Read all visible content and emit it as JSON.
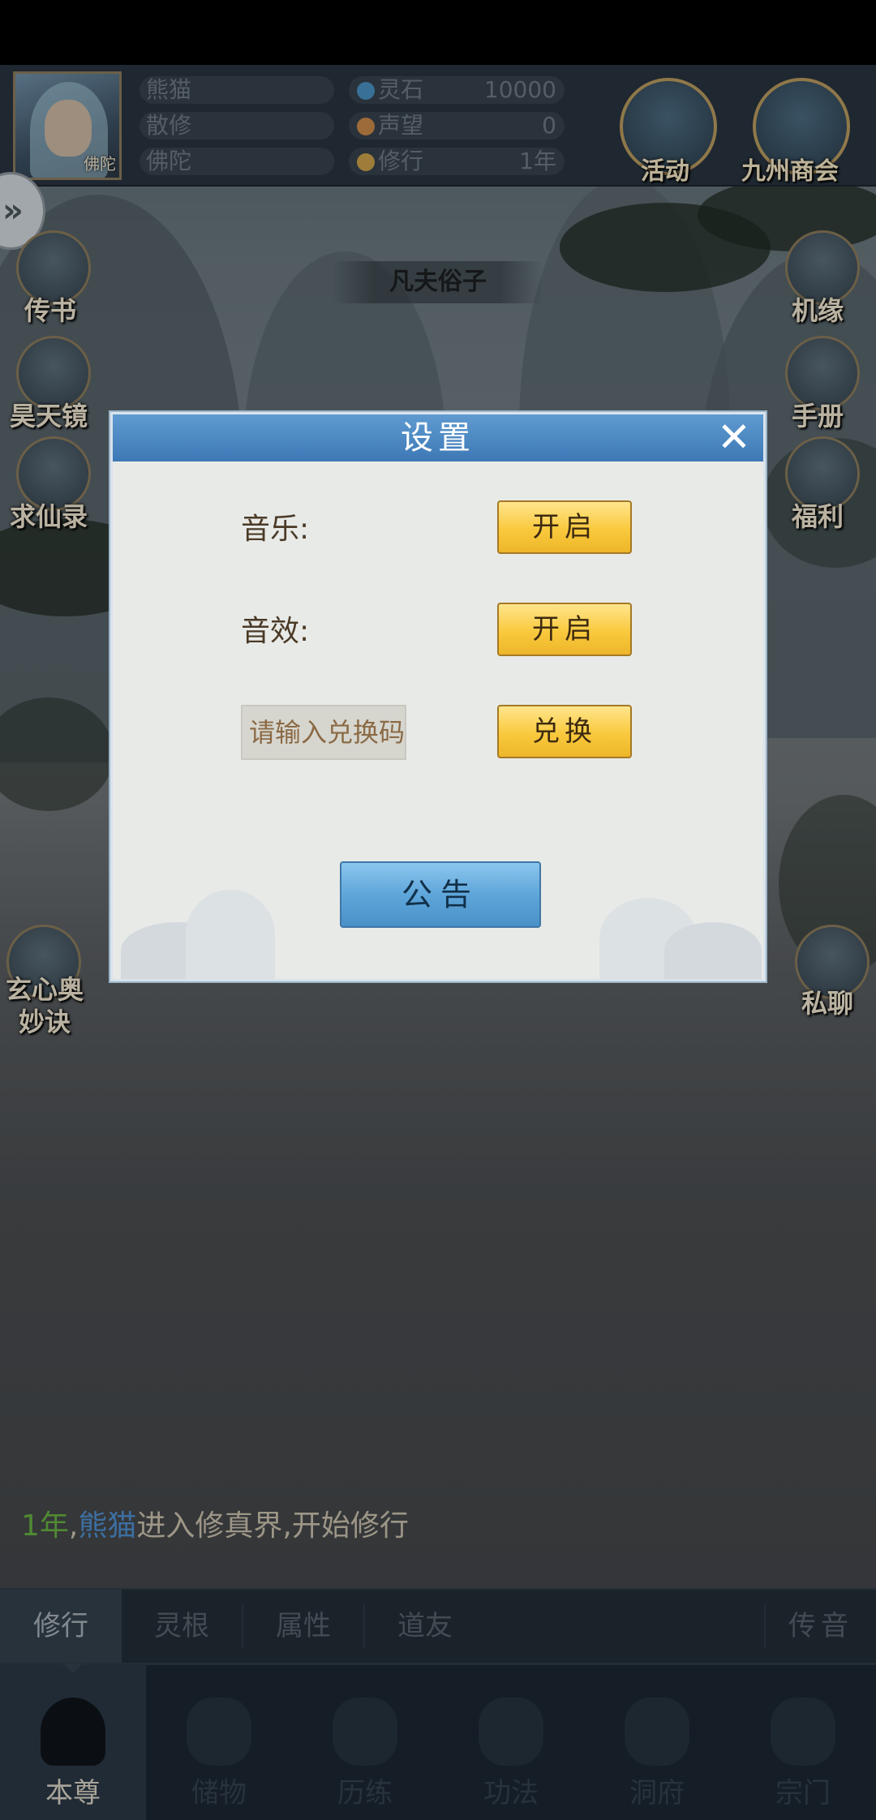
{
  "player": {
    "name": "熊猫",
    "sect": "散修",
    "race": "佛陀",
    "avatar_realm": "佛陀"
  },
  "resources": [
    {
      "label": "灵石",
      "value": "10000",
      "icon": "spirit-stone-icon",
      "color": "#4a90c2"
    },
    {
      "label": "声望",
      "value": "0",
      "icon": "reputation-icon",
      "color": "#c9894a"
    },
    {
      "label": "修行",
      "value": "1年",
      "icon": "cultivation-icon",
      "color": "#c9a04a"
    }
  ],
  "top_buttons": {
    "activity": "活动",
    "shop": "九州商会"
  },
  "left_buttons": [
    "传书",
    "昊天镜",
    "求仙录"
  ],
  "left_bottom_button": "玄心奥妙诀",
  "right_buttons": [
    "机缘",
    "手册",
    "福利"
  ],
  "right_bottom_button": "私聊",
  "scene_title": "凡夫俗子",
  "log": {
    "year": "1年",
    "separator": ",",
    "name": "熊猫",
    "text": "进入修真界,开始修行"
  },
  "tabs": [
    "修行",
    "灵根",
    "属性",
    "道友",
    "传音"
  ],
  "nav": [
    "本尊",
    "储物",
    "历练",
    "功法",
    "洞府",
    "宗门"
  ],
  "dialog": {
    "title": "设置",
    "close": "✕",
    "music_label": "音乐:",
    "music_button": "开启",
    "sfx_label": "音效:",
    "sfx_button": "开启",
    "code_placeholder": "请输入兑换码",
    "redeem_button": "兑换",
    "notice_button": "公告"
  }
}
